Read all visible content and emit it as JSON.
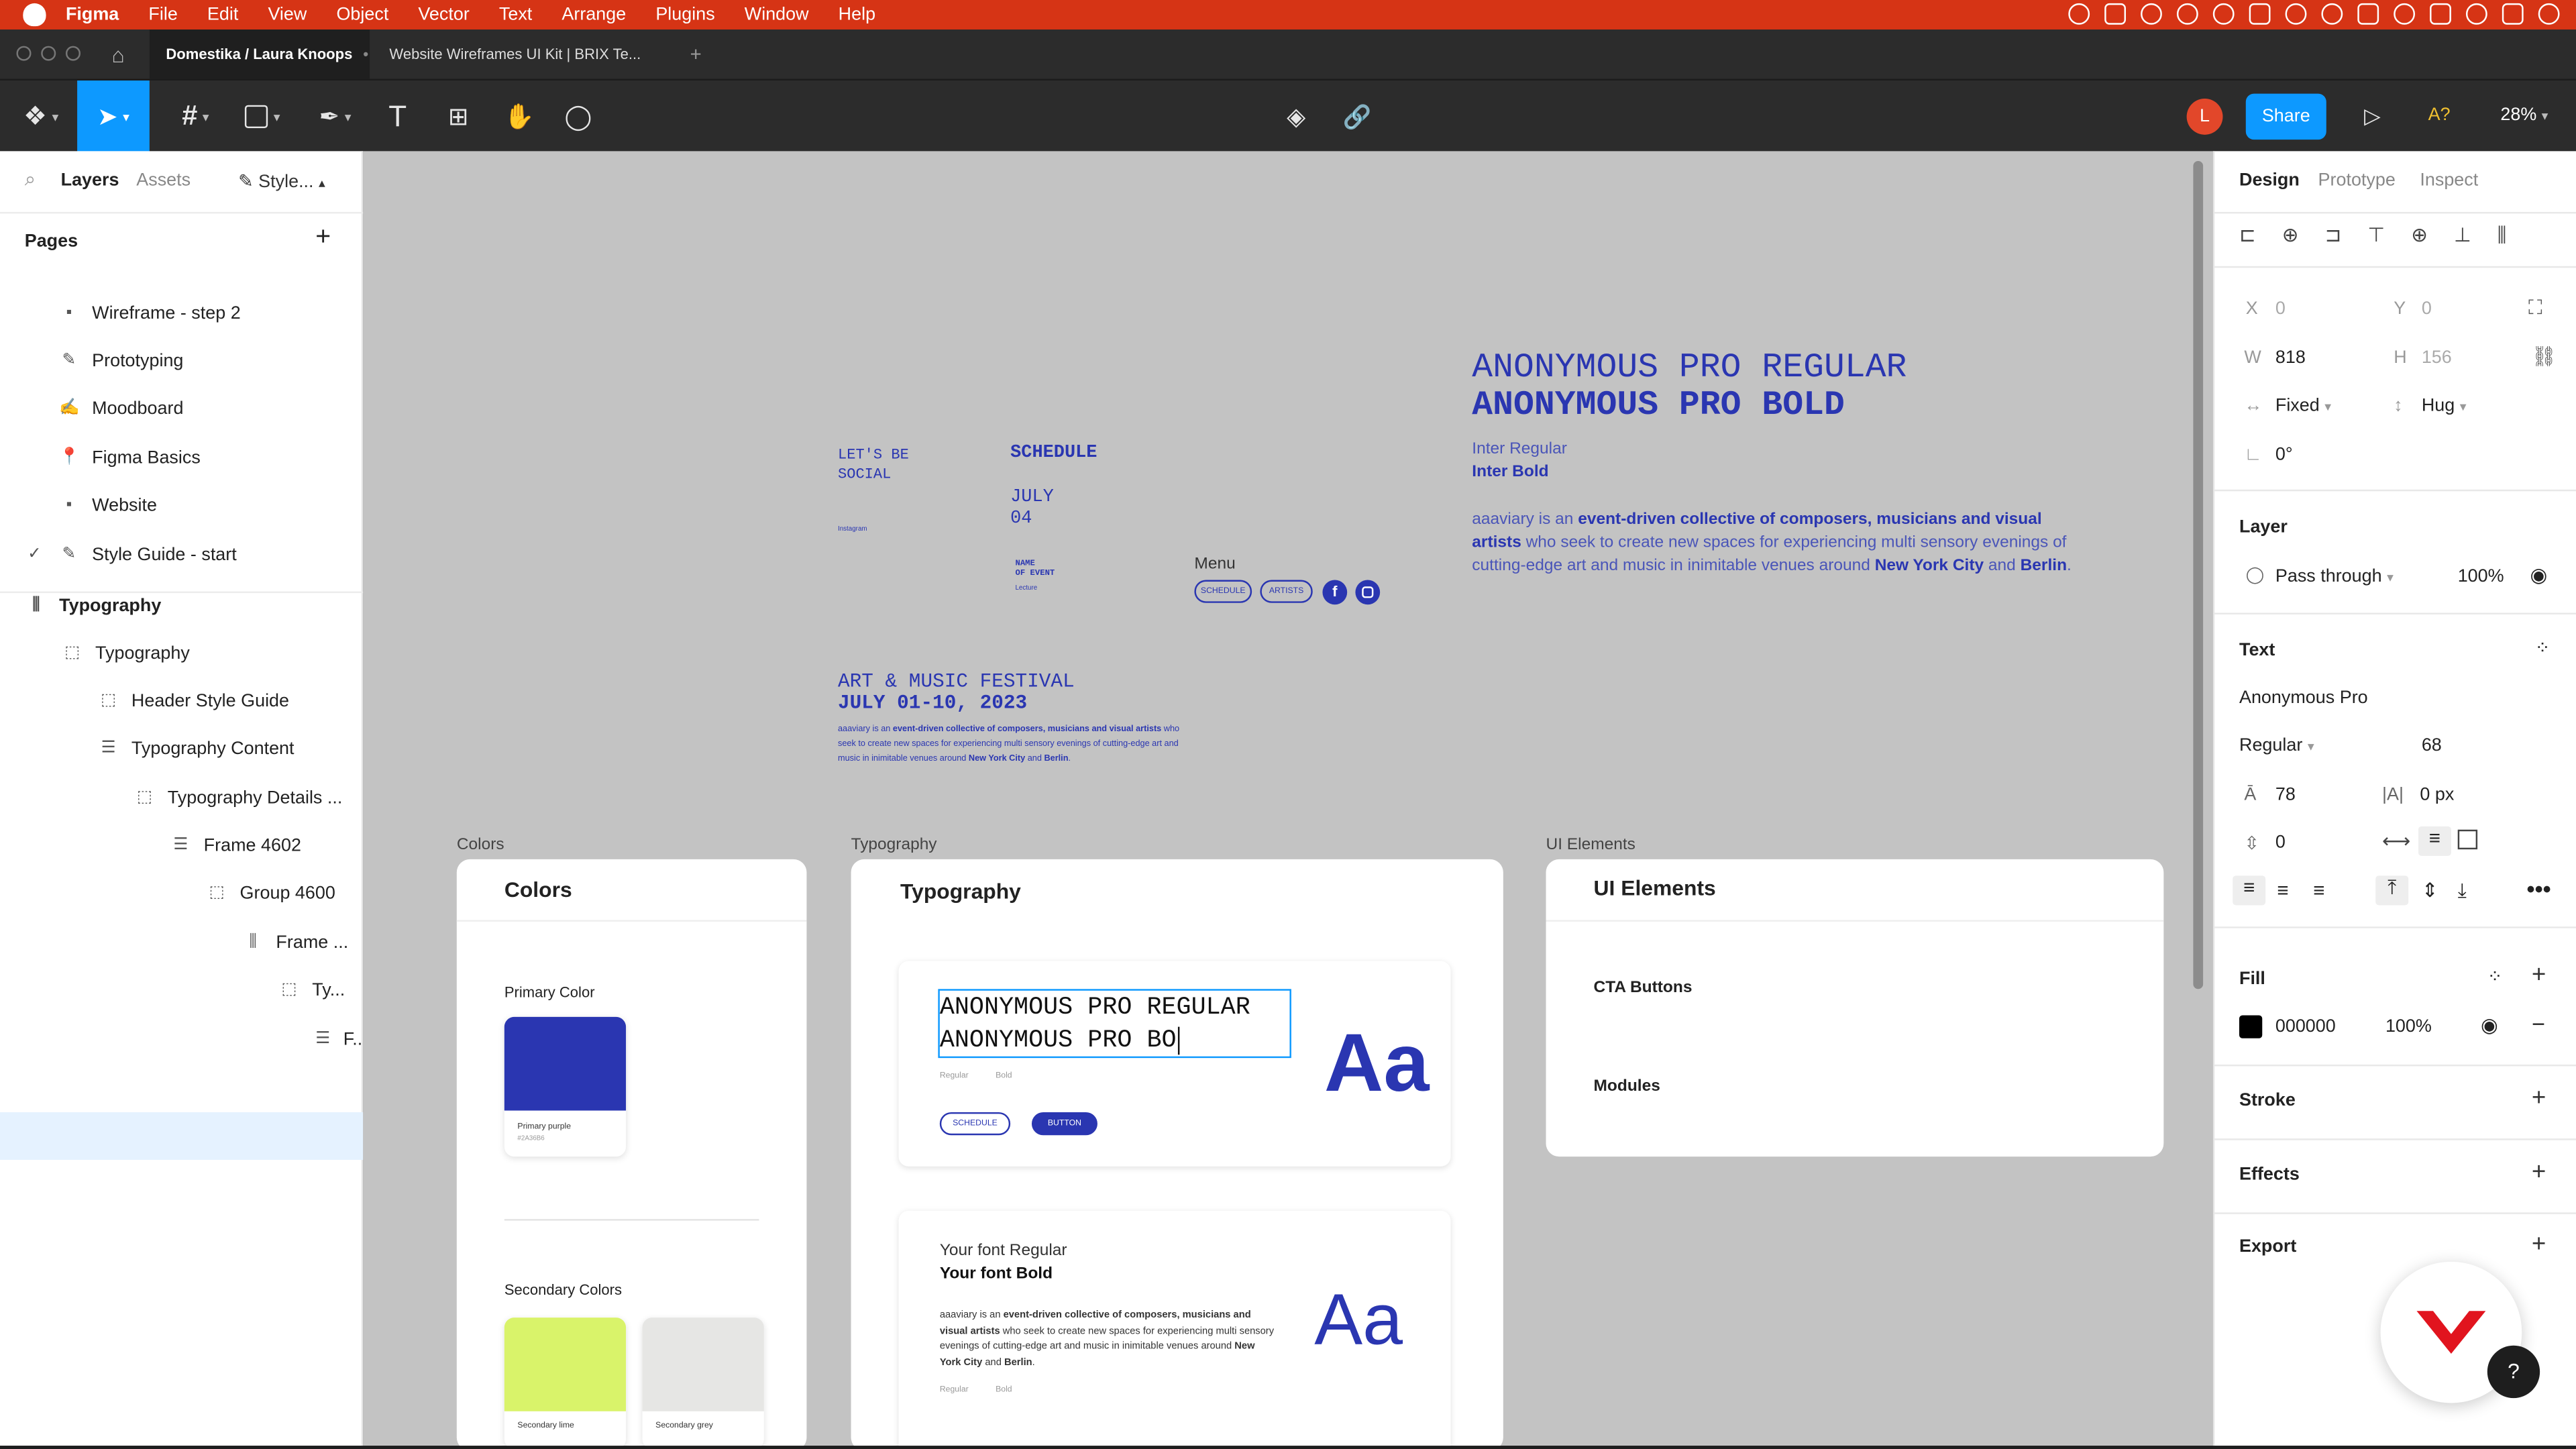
{
  "menubar": {
    "app": "Figma",
    "items": [
      "File",
      "Edit",
      "View",
      "Object",
      "Vector",
      "Text",
      "Arrange",
      "Plugins",
      "Window",
      "Help"
    ]
  },
  "tabs": {
    "active": "Domestika / Laura Knoops",
    "second": "Website Wireframes UI Kit | BRIX Te...",
    "add": "+"
  },
  "toolbar": {
    "share": "Share",
    "avatar": "L",
    "zoom": "28%",
    "font_warn": "A?"
  },
  "left": {
    "tabs": [
      "Layers",
      "Assets",
      "Style..."
    ],
    "pages_title": "Pages",
    "pages": [
      {
        "icon": "▪",
        "label": "Wireframe - step 2"
      },
      {
        "icon": "✎",
        "label": "Prototyping"
      },
      {
        "icon": "✍",
        "label": "Moodboard"
      },
      {
        "icon": "📍",
        "label": "Figma Basics"
      },
      {
        "icon": "▪",
        "label": "Website"
      },
      {
        "icon": "✎",
        "label": "Style Guide - start"
      }
    ],
    "layers": [
      "Typography",
      "Typography",
      "Header Style Guide",
      "Typography Content",
      "Typography Details ...",
      "Frame 4602",
      "Group 4600",
      "Frame ...",
      "Ty...",
      "F..."
    ]
  },
  "canvas": {
    "social": "LET'S BE\nSOCIAL",
    "instagram": "Instagram",
    "schedule": "SCHEDULE",
    "date": "JULY\n04",
    "event": "NAME\nOF EVENT",
    "lecture": "Lecture",
    "menu": "Menu",
    "pill_schedule": "SCHEDULE",
    "pill_artists": "ARTISTS",
    "fb": "f",
    "festival": "ART & MUSIC FESTIVAL",
    "festival_date": "JULY 01-10, 2023",
    "small_p1": "aaaviary is an ",
    "small_p2": "event-driven collective of composers, musicians and visual artists",
    "small_p3": " who seek to create new spaces for experiencing multi sensory evenings of cutting-edge art and music in inimitable venues around ",
    "small_p4": "New York City",
    "small_p5": " and ",
    "small_p6": "Berlin",
    "small_p7": ".",
    "h_regular": "ANONYMOUS PRO REGULAR",
    "h_bold": "ANONYMOUS PRO BOLD",
    "inter_regular": "Inter Regular",
    "inter_bold": "Inter Bold",
    "big_p1": "aaaviary is an ",
    "big_p2": "event-driven collective of composers, musicians and visual artists",
    "big_p3": " who seek to create new spaces for experiencing multi sensory evenings of cutting-edge art and music in inimitable venues around ",
    "big_p4": "New York City",
    "big_p5": " and ",
    "big_p6": "Berlin",
    "big_p7": ".",
    "frame_colors": "Colors",
    "frame_typo": "Typography",
    "frame_ui": "UI Elements",
    "colors_title": "Colors",
    "primary_color": "Primary Color",
    "primary_name": "Primary purple",
    "primary_hex": "#2A36B6",
    "secondary_colors": "Secondary Colors",
    "sec1": "Secondary lime",
    "sec2": "Secondary grey",
    "typo_title": "Typography",
    "edit_l1": "ANONYMOUS PRO REGULAR",
    "edit_l2": "ANONYMOUS PRO BO",
    "lbl_regular": "Regular",
    "lbl_bold": "Bold",
    "btn_schedule": "SCHEDULE",
    "btn_button": "BUTTON",
    "aa": "Aa",
    "yf_regular": "Your font Regular",
    "yf_bold": "Your font Bold",
    "ui_title": "UI Elements",
    "cta": "CTA Buttons",
    "modules": "Modules"
  },
  "right": {
    "tabs": [
      "Design",
      "Prototype",
      "Inspect"
    ],
    "x_label": "X",
    "x": "0",
    "y_label": "Y",
    "y": "0",
    "w_label": "W",
    "w": "818",
    "h_label": "H",
    "h": "156",
    "fixed": "Fixed",
    "hug": "Hug",
    "rotation": "0°",
    "layer_title": "Layer",
    "blend": "Pass through",
    "opacity": "100%",
    "text_title": "Text",
    "font": "Anonymous Pro",
    "weight": "Regular",
    "size": "68",
    "line_height": "78",
    "letter_spacing": "0 px",
    "para_spacing": "0",
    "fill_title": "Fill",
    "fill_hex": "000000",
    "fill_opacity": "100%",
    "stroke": "Stroke",
    "effects": "Effects",
    "export": "Export",
    "help": "?"
  },
  "colors": {
    "accent": "#0d99ff",
    "brand_blue": "#2a36b1",
    "lime": "#d9f36a",
    "grey": "#e6e6e4",
    "menubar": "#d63415"
  }
}
